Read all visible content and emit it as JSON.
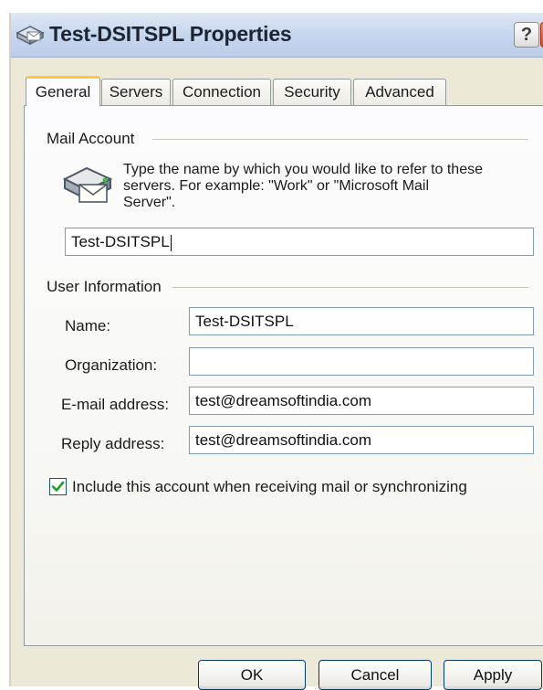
{
  "window": {
    "title": "Test-DSITSPL Properties",
    "help_label": "?"
  },
  "tabs": [
    {
      "label": "General",
      "active": true
    },
    {
      "label": "Servers",
      "active": false
    },
    {
      "label": "Connection",
      "active": false
    },
    {
      "label": "Security",
      "active": false
    },
    {
      "label": "Advanced",
      "active": false
    }
  ],
  "mail_account": {
    "section_label": "Mail Account",
    "description_lines": [
      "Type the name by which you would like to refer to these",
      "servers.  For example: \"Work\" or \"Microsoft Mail",
      "Server\"."
    ],
    "account_name_value": "Test-DSITSPL"
  },
  "user_information": {
    "section_label": "User Information",
    "name_label": "Name:",
    "name_value": "Test-DSITSPL",
    "organization_label": "Organization:",
    "organization_value": "",
    "email_label": "E-mail address:",
    "email_value": "test@dreamsoftindia.com",
    "reply_label": "Reply address:",
    "reply_value": "test@dreamsoftindia.com"
  },
  "include_account": {
    "label": "Include this account when receiving mail or synchronizing",
    "checked": true
  },
  "buttons": {
    "ok": "OK",
    "cancel": "Cancel",
    "apply": "Apply"
  },
  "colors": {
    "tab_highlight": "#ffc83c",
    "close_button": "#d7492a",
    "checkbox_check": "#21a121"
  }
}
